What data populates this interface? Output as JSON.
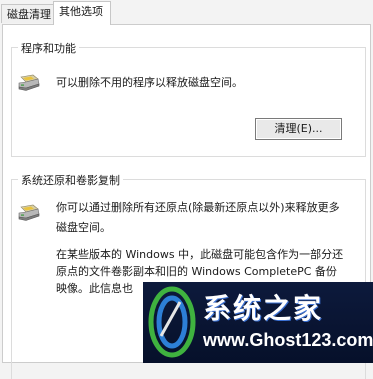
{
  "tabs": {
    "disk_cleanup": "磁盘清理",
    "more_options": "其他选项"
  },
  "programs": {
    "heading": "程序和功能",
    "description": "可以删除不用的程序以释放磁盘空间。",
    "button_label": "清理(E)..."
  },
  "restore": {
    "heading": "系统还原和卷影复制",
    "desc_line1": "你可以通过删除所有还原点(除最新还原点以外)来释放更多",
    "desc_line2": "磁盘空间。",
    "info_line1": "在某些版本的 Windows 中，此磁盘可能包含作为一部分还",
    "info_line2": "原点的文件卷影副本和旧的 Windows CompletePC 备份",
    "info_line3": "映像。此信息也"
  },
  "watermark": {
    "title": "系统之家",
    "url": "www.Ghost123.com"
  },
  "colors": {
    "panel_background": "#ffffff",
    "window_background": "#f3f3f3",
    "watermark_background": "#0d1a3c"
  }
}
